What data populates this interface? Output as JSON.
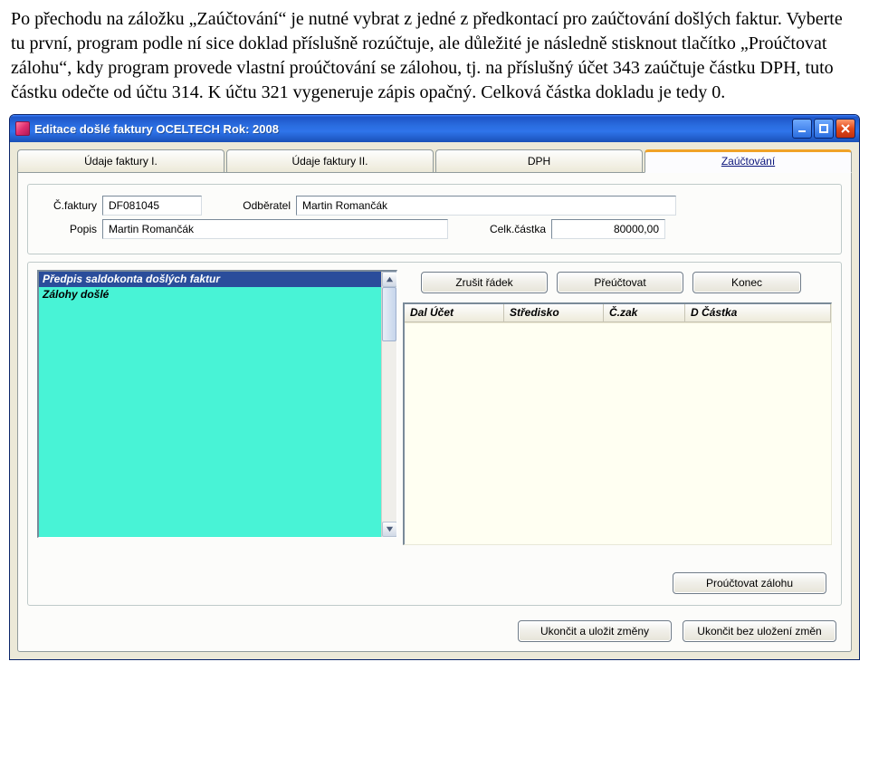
{
  "doc_paragraph": "Po přechodu na záložku „Zaúčtování“ je nutné vybrat z jedné z předkontací pro zaúčtování došlých faktur. Vyberte tu první, program podle ní sice doklad příslušně rozúčtuje, ale důležité je následně stisknout tlačítko „Proúčtovat zálohu“, kdy program provede vlastní proúčtování se zálohou, tj. na příslušný účet 343 zaúčtuje částku DPH, tuto částku odečte od účtu 314. K účtu 321 vygeneruje zápis opačný. Celková částka dokladu je tedy 0.",
  "window": {
    "title": "Editace došlé faktury  OCELTECH  Rok: 2008"
  },
  "tabs": {
    "t1": "Údaje faktury I.",
    "t2": "Údaje faktury II.",
    "t3": "DPH",
    "t4": "Zaúčtování"
  },
  "header": {
    "cfaktury_lbl": "Č.faktury",
    "cfaktury_val": "DF081045",
    "odberatel_lbl": "Odběratel",
    "odberatel_val": "Martin Romančák",
    "popis_lbl": "Popis",
    "popis_val": "Martin Romančák",
    "celkcastka_lbl": "Celk.částka",
    "celkcastka_val": "80000,00"
  },
  "listbox": {
    "item0": "Předpis saldokonta došlých faktur",
    "item1": "Zálohy došlé"
  },
  "actions": {
    "zrusit": "Zrušit řádek",
    "preuctovat": "Přeúčtovat",
    "konec": "Konec"
  },
  "grid": {
    "c1": "Dal Účet",
    "c2": "Středisko",
    "c3": "Č.zak",
    "c4": "D Částka"
  },
  "footer": {
    "prouctovat_zalohu": "Proúčtovat zálohu",
    "save": "Ukončit a uložit změny",
    "cancel": "Ukončit bez uložení změn"
  }
}
